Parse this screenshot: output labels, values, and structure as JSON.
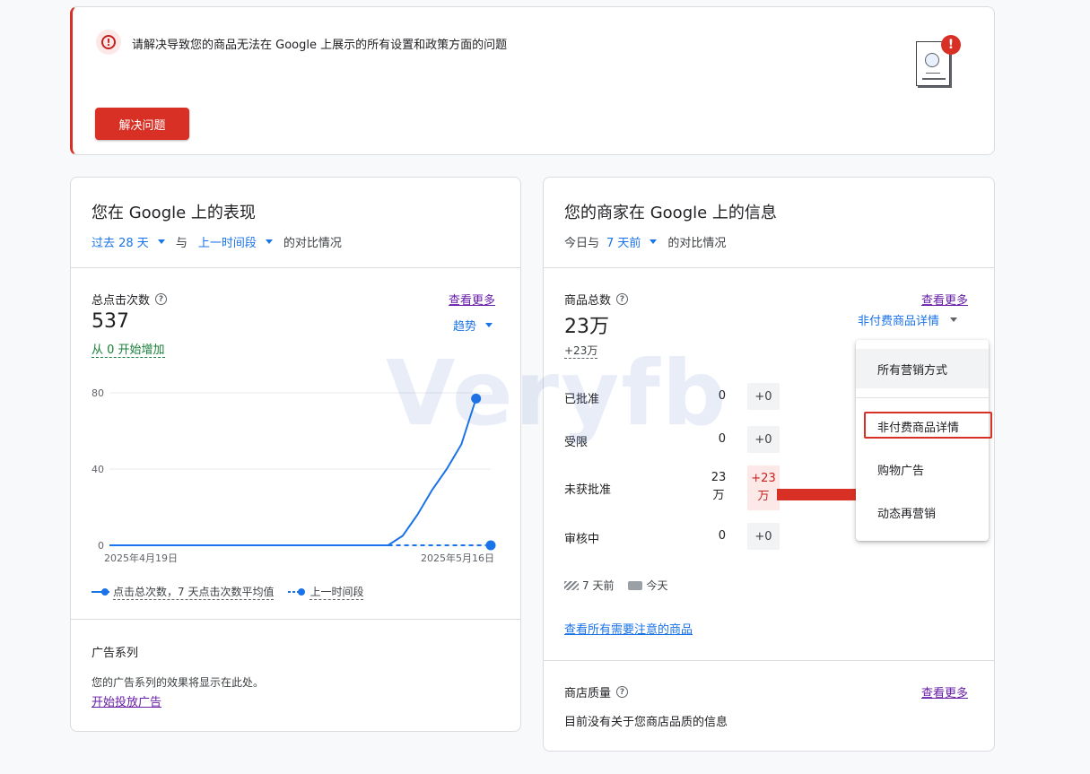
{
  "alert": {
    "icon": "error-icon",
    "message": "请解决导致您的商品无法在 Google 上展示的所有设置和政策方面的问题",
    "button_label": "解决问题",
    "badge": "!"
  },
  "performance": {
    "title": "您在 Google 上的表现",
    "period_label": "过去 28 天",
    "with_label": "与",
    "compare_label": "上一时间段",
    "suffix": "的对比情况",
    "metric_label": "总点击次数",
    "metric_value": "537",
    "see_more": "查看更多",
    "trend_label": "趋势",
    "increase_text": "从 0 开始增加",
    "legend_current": "点击总次数，7 天点击次数平均值",
    "legend_previous": "上一时间段",
    "campaigns_title": "广告系列",
    "campaigns_desc": "您的广告系列的效果将显示在此处。",
    "campaigns_link": "开始投放广告"
  },
  "chart_data": {
    "type": "line",
    "x_start_label": "2025年4月19日",
    "x_end_label": "2025年5月16日",
    "yticks": [
      "80",
      "40",
      "0"
    ],
    "ylim": [
      0,
      80
    ],
    "x": [
      0,
      19,
      20,
      21,
      22,
      23,
      24,
      25,
      26
    ],
    "series": [
      {
        "values": [
          0,
          0,
          5,
          16,
          29,
          40,
          53,
          77,
          0
        ],
        "style": "solid"
      },
      {
        "values": [
          0,
          0,
          0,
          0,
          0,
          0,
          0,
          0,
          0
        ],
        "style": "dashed"
      }
    ],
    "color": "#1a73e8"
  },
  "merchant": {
    "title": "您的商家在 Google 上的信息",
    "today_label": "今日与",
    "compare_label": "7 天前",
    "suffix": "的对比情况",
    "metric_label": "商品总数",
    "metric_value": "23万",
    "metric_delta": "+23万",
    "see_more": "查看更多",
    "dropdown_label": "非付费商品详情",
    "statuses": [
      {
        "name": "已批准",
        "value": "0",
        "delta": "+0"
      },
      {
        "name": "受限",
        "value": "0",
        "delta": "+0"
      },
      {
        "name": "未获批准",
        "value_line1": "23",
        "value_line2": "万",
        "delta_line1": "+23",
        "delta_line2": "万"
      },
      {
        "name": "审核中",
        "value": "0",
        "delta": "+0"
      }
    ],
    "legend_past": "7 天前",
    "legend_today": "今天",
    "view_all_link": "查看所有需要注意的商品",
    "quality_label": "商店质量",
    "quality_see_more": "查看更多",
    "quality_desc": "目前没有关于您商店品质的信息"
  },
  "menu": {
    "items": [
      "所有营销方式",
      "非付费商品详情",
      "购物广告",
      "动态再营销"
    ]
  },
  "watermark": "Veryfb"
}
